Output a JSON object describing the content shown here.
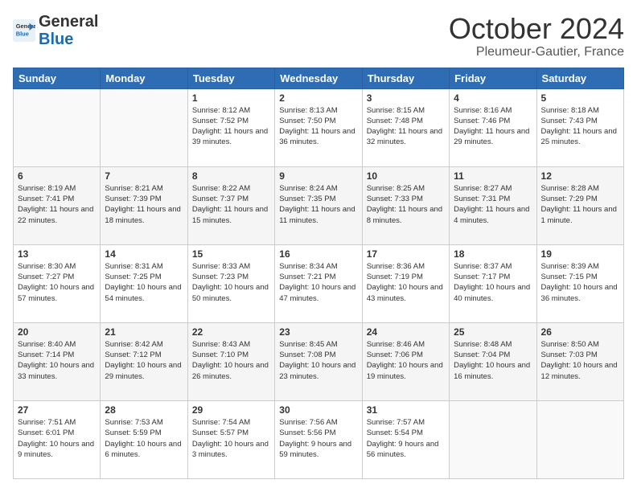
{
  "header": {
    "logo_line1": "General",
    "logo_line2": "Blue",
    "main_title": "October 2024",
    "subtitle": "Pleumeur-Gautier, France"
  },
  "days_of_week": [
    "Sunday",
    "Monday",
    "Tuesday",
    "Wednesday",
    "Thursday",
    "Friday",
    "Saturday"
  ],
  "weeks": [
    [
      {
        "day": "",
        "info": ""
      },
      {
        "day": "",
        "info": ""
      },
      {
        "day": "1",
        "info": "Sunrise: 8:12 AM\nSunset: 7:52 PM\nDaylight: 11 hours and 39 minutes."
      },
      {
        "day": "2",
        "info": "Sunrise: 8:13 AM\nSunset: 7:50 PM\nDaylight: 11 hours and 36 minutes."
      },
      {
        "day": "3",
        "info": "Sunrise: 8:15 AM\nSunset: 7:48 PM\nDaylight: 11 hours and 32 minutes."
      },
      {
        "day": "4",
        "info": "Sunrise: 8:16 AM\nSunset: 7:46 PM\nDaylight: 11 hours and 29 minutes."
      },
      {
        "day": "5",
        "info": "Sunrise: 8:18 AM\nSunset: 7:43 PM\nDaylight: 11 hours and 25 minutes."
      }
    ],
    [
      {
        "day": "6",
        "info": "Sunrise: 8:19 AM\nSunset: 7:41 PM\nDaylight: 11 hours and 22 minutes."
      },
      {
        "day": "7",
        "info": "Sunrise: 8:21 AM\nSunset: 7:39 PM\nDaylight: 11 hours and 18 minutes."
      },
      {
        "day": "8",
        "info": "Sunrise: 8:22 AM\nSunset: 7:37 PM\nDaylight: 11 hours and 15 minutes."
      },
      {
        "day": "9",
        "info": "Sunrise: 8:24 AM\nSunset: 7:35 PM\nDaylight: 11 hours and 11 minutes."
      },
      {
        "day": "10",
        "info": "Sunrise: 8:25 AM\nSunset: 7:33 PM\nDaylight: 11 hours and 8 minutes."
      },
      {
        "day": "11",
        "info": "Sunrise: 8:27 AM\nSunset: 7:31 PM\nDaylight: 11 hours and 4 minutes."
      },
      {
        "day": "12",
        "info": "Sunrise: 8:28 AM\nSunset: 7:29 PM\nDaylight: 11 hours and 1 minute."
      }
    ],
    [
      {
        "day": "13",
        "info": "Sunrise: 8:30 AM\nSunset: 7:27 PM\nDaylight: 10 hours and 57 minutes."
      },
      {
        "day": "14",
        "info": "Sunrise: 8:31 AM\nSunset: 7:25 PM\nDaylight: 10 hours and 54 minutes."
      },
      {
        "day": "15",
        "info": "Sunrise: 8:33 AM\nSunset: 7:23 PM\nDaylight: 10 hours and 50 minutes."
      },
      {
        "day": "16",
        "info": "Sunrise: 8:34 AM\nSunset: 7:21 PM\nDaylight: 10 hours and 47 minutes."
      },
      {
        "day": "17",
        "info": "Sunrise: 8:36 AM\nSunset: 7:19 PM\nDaylight: 10 hours and 43 minutes."
      },
      {
        "day": "18",
        "info": "Sunrise: 8:37 AM\nSunset: 7:17 PM\nDaylight: 10 hours and 40 minutes."
      },
      {
        "day": "19",
        "info": "Sunrise: 8:39 AM\nSunset: 7:15 PM\nDaylight: 10 hours and 36 minutes."
      }
    ],
    [
      {
        "day": "20",
        "info": "Sunrise: 8:40 AM\nSunset: 7:14 PM\nDaylight: 10 hours and 33 minutes."
      },
      {
        "day": "21",
        "info": "Sunrise: 8:42 AM\nSunset: 7:12 PM\nDaylight: 10 hours and 29 minutes."
      },
      {
        "day": "22",
        "info": "Sunrise: 8:43 AM\nSunset: 7:10 PM\nDaylight: 10 hours and 26 minutes."
      },
      {
        "day": "23",
        "info": "Sunrise: 8:45 AM\nSunset: 7:08 PM\nDaylight: 10 hours and 23 minutes."
      },
      {
        "day": "24",
        "info": "Sunrise: 8:46 AM\nSunset: 7:06 PM\nDaylight: 10 hours and 19 minutes."
      },
      {
        "day": "25",
        "info": "Sunrise: 8:48 AM\nSunset: 7:04 PM\nDaylight: 10 hours and 16 minutes."
      },
      {
        "day": "26",
        "info": "Sunrise: 8:50 AM\nSunset: 7:03 PM\nDaylight: 10 hours and 12 minutes."
      }
    ],
    [
      {
        "day": "27",
        "info": "Sunrise: 7:51 AM\nSunset: 6:01 PM\nDaylight: 10 hours and 9 minutes."
      },
      {
        "day": "28",
        "info": "Sunrise: 7:53 AM\nSunset: 5:59 PM\nDaylight: 10 hours and 6 minutes."
      },
      {
        "day": "29",
        "info": "Sunrise: 7:54 AM\nSunset: 5:57 PM\nDaylight: 10 hours and 3 minutes."
      },
      {
        "day": "30",
        "info": "Sunrise: 7:56 AM\nSunset: 5:56 PM\nDaylight: 9 hours and 59 minutes."
      },
      {
        "day": "31",
        "info": "Sunrise: 7:57 AM\nSunset: 5:54 PM\nDaylight: 9 hours and 56 minutes."
      },
      {
        "day": "",
        "info": ""
      },
      {
        "day": "",
        "info": ""
      }
    ]
  ]
}
